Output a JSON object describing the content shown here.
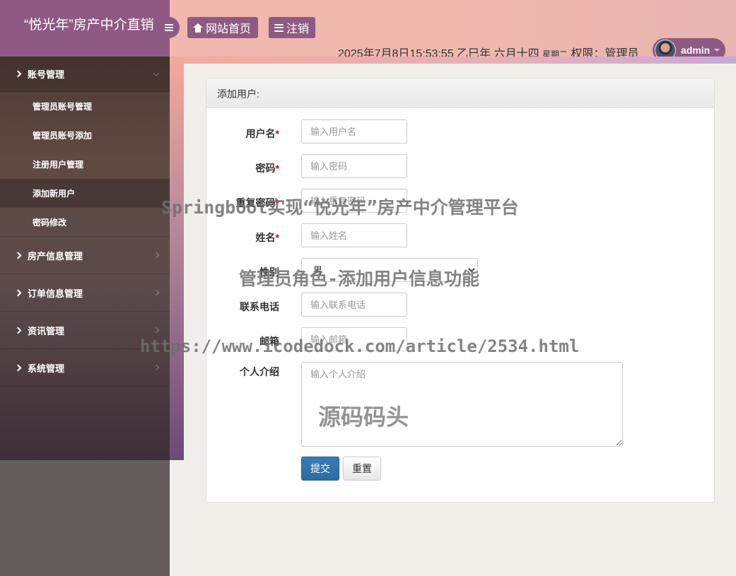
{
  "header": {
    "brand_title": "“悦光年”房产中介直销",
    "home_label": "网站首页",
    "logout_label": "注销",
    "datetime": "2025年7月8日15:53:55 乙巳年 六月十四",
    "weekday": "星期二",
    "role_text": "权限：管理员",
    "username": "admin"
  },
  "sidebar": {
    "groups": [
      {
        "label": "账号管理"
      },
      {
        "label": "房产信息管理"
      },
      {
        "label": "订单信息管理"
      },
      {
        "label": "资讯管理"
      },
      {
        "label": "系统管理"
      }
    ],
    "sub_items": [
      {
        "label": "管理员账号管理"
      },
      {
        "label": "管理员账号添加"
      },
      {
        "label": "注册用户管理"
      },
      {
        "label": "添加新用户"
      },
      {
        "label": "密码修改"
      }
    ]
  },
  "panel": {
    "title": "添加用户:",
    "fields": {
      "username": {
        "label": "用户名",
        "placeholder": "输入用户名"
      },
      "password": {
        "label": "密码",
        "placeholder": "输入密码"
      },
      "confirm_password": {
        "label": "重复密码",
        "placeholder": "输入重复密码"
      },
      "realname": {
        "label": "姓名",
        "placeholder": "输入姓名"
      },
      "gender": {
        "label": "性别",
        "selected": "男"
      },
      "phone": {
        "label": "联系电话",
        "placeholder": "输入联系电话"
      },
      "email": {
        "label": "邮箱",
        "placeholder": "输入邮箱"
      },
      "intro": {
        "label": "个人介绍",
        "placeholder": "输入个人介绍"
      }
    },
    "required_mark": "*",
    "submit_label": "提交",
    "reset_label": "重置"
  },
  "watermarks": {
    "line1": "Springboot实现“悦光年”房产中介管理平台",
    "line2": "管理员角色-添加用户信息功能",
    "line3": "https://www.icodedock.com/article/2534.html",
    "line4": "源码码头"
  },
  "colors": {
    "brand_purple": "#8e5a83",
    "header_pink": "#f2b8ad",
    "primary_button": "#2d6ca2",
    "required_red": "#cc0000"
  },
  "icons": {
    "menu_toggle": "bars-icon",
    "home": "home-icon",
    "logout": "bars-icon",
    "user_caret": "caret-down-icon",
    "group_chevron": "chevron-right-icon"
  }
}
